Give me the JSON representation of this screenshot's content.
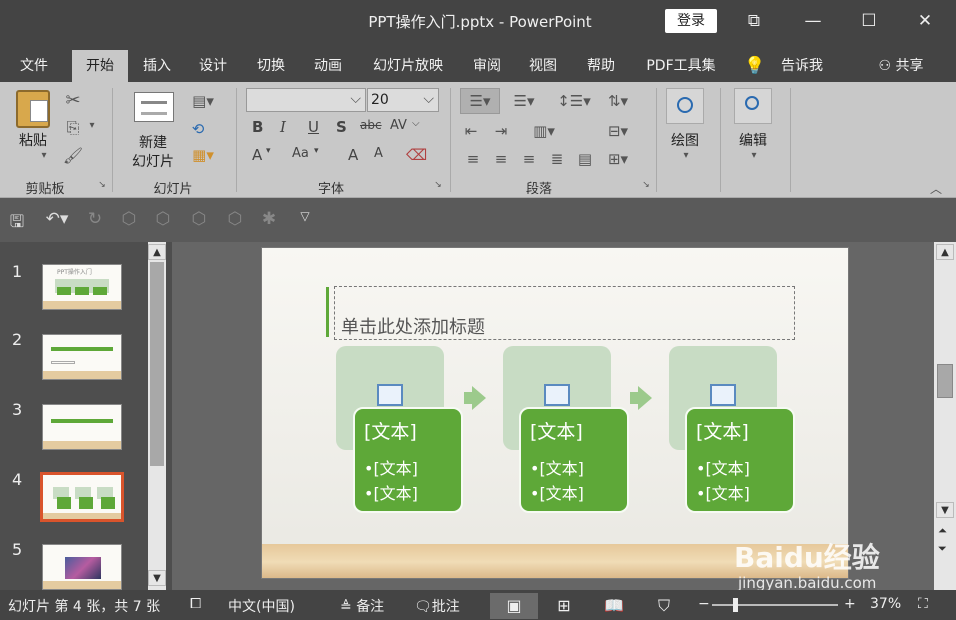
{
  "app": {
    "title": "PPT操作入门.pptx  -  PowerPoint",
    "login_label": "登录"
  },
  "tabs": [
    "文件",
    "开始",
    "插入",
    "设计",
    "切换",
    "动画",
    "幻灯片放映",
    "审阅",
    "视图",
    "帮助",
    "PDF工具集"
  ],
  "tell_me": "告诉我",
  "share": "共享",
  "ribbon": {
    "clipboard": {
      "paste": "粘贴",
      "label": "剪贴板"
    },
    "slides": {
      "new_slide_line1": "新建",
      "new_slide_line2": "幻灯片",
      "label": "幻灯片"
    },
    "font": {
      "font_name": "",
      "font_size": "20",
      "label": "字体",
      "bold": "B",
      "italic": "I",
      "underline": "U",
      "shadow": "S",
      "strike": "abc",
      "spacing": "AV",
      "color": "A",
      "case": "Aa",
      "grow": "A",
      "shrink": "A"
    },
    "paragraph": {
      "label": "段落"
    },
    "drawing": {
      "label": "绘图"
    },
    "editing": {
      "label": "编辑"
    }
  },
  "slides": [
    {
      "number": "1",
      "title": "PPT操作入门"
    },
    {
      "number": "2"
    },
    {
      "number": "3"
    },
    {
      "number": "4"
    },
    {
      "number": "5"
    }
  ],
  "current_slide": {
    "title_placeholder": "单击此处添加标题",
    "cards": [
      {
        "heading": "[文本]",
        "bullets": [
          "•[文本]",
          "•[文本]"
        ]
      },
      {
        "heading": "[文本]",
        "bullets": [
          "•[文本]",
          "•[文本]"
        ]
      },
      {
        "heading": "[文本]",
        "bullets": [
          "•[文本]",
          "•[文本]"
        ]
      }
    ]
  },
  "status": {
    "slide_info": "幻灯片 第 4 张，共 7 张",
    "language": "中文(中国)",
    "notes": "备注",
    "comments": "批注",
    "zoom": "37%",
    "zoom_fraction": 0.37
  },
  "watermark": {
    "brand": "Baidu经验",
    "url": "jingyan.baidu.com"
  },
  "colors": {
    "accent_green": "#5ea838",
    "light_green": "#c8dcc4",
    "selected_border": "#d9542c"
  }
}
